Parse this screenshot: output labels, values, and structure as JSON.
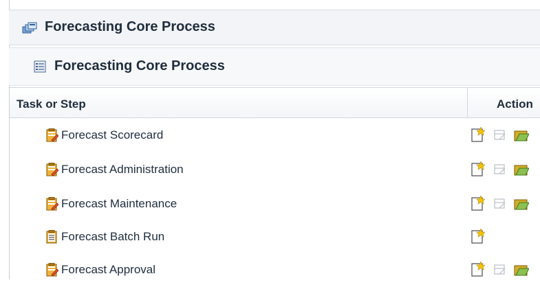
{
  "page": {
    "outer_title": "Forecasting Core Process",
    "inner_title": "Forecasting Core Process"
  },
  "table": {
    "columns": {
      "task": "Task or Step",
      "action": "Action"
    },
    "rows": [
      {
        "label": "Forecast Scorecard",
        "icon": "task-edit-icon",
        "actions": [
          "new-icon",
          "edit-icon",
          "open-icon"
        ]
      },
      {
        "label": "Forecast Administration",
        "icon": "task-edit-icon",
        "actions": [
          "new-icon",
          "edit-icon",
          "open-icon"
        ]
      },
      {
        "label": "Forecast Maintenance",
        "icon": "task-edit-icon",
        "actions": [
          "new-icon",
          "edit-icon",
          "open-icon"
        ]
      },
      {
        "label": "Forecast Batch Run",
        "icon": "task-list-icon",
        "actions": [
          "new-icon"
        ]
      },
      {
        "label": "Forecast Approval",
        "icon": "task-edit-icon",
        "actions": [
          "new-icon",
          "edit-icon",
          "open-icon"
        ]
      }
    ]
  },
  "colors": {
    "header_bg": "#f2f4f7",
    "text": "#1f2d3d",
    "border": "#d1d7de",
    "icon_gold": "#e8a31a",
    "icon_green": "#79b842"
  }
}
